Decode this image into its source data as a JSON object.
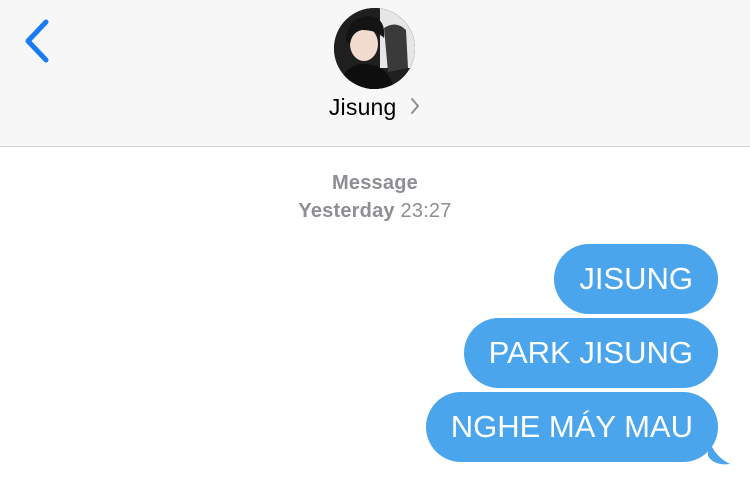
{
  "header": {
    "back_icon": "chevron-left-icon",
    "contact_name": "Jisung",
    "contact_chevron_icon": "chevron-right-icon",
    "accent_color": "#1a7cf5"
  },
  "conversation": {
    "service_label": "Message",
    "day": "Yesterday",
    "time": "23:27",
    "bubble_color": "#4aa5ec",
    "messages": [
      {
        "text": "JISUNG"
      },
      {
        "text": "PARK JISUNG"
      },
      {
        "text": "NGHE MÁY MAU"
      }
    ]
  }
}
